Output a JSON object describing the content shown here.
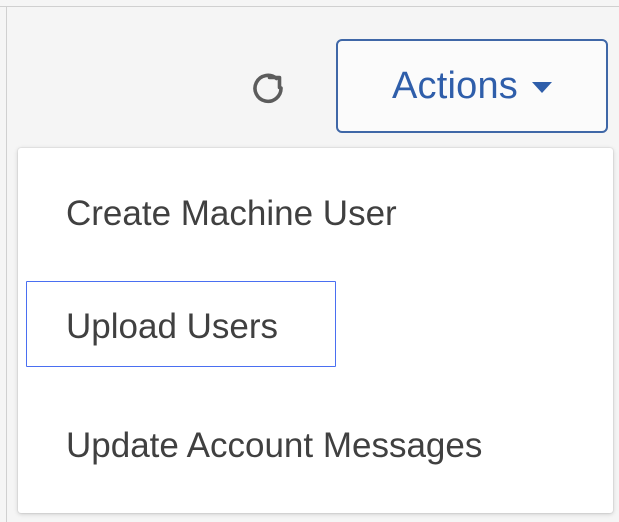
{
  "toolbar": {
    "refresh_icon": "refresh-icon",
    "actions_label": "Actions",
    "actions_caret": "caret-down-icon"
  },
  "dropdown": {
    "items": [
      {
        "label": "Create Machine User"
      },
      {
        "label": "Upload Users",
        "focused": true
      },
      {
        "label": "Update Account Messages"
      }
    ]
  },
  "colors": {
    "accent": "#2f5eaa",
    "focus": "#4a6ff1",
    "text": "#404040",
    "menu_bg": "#ffffff",
    "page_bg": "#f5f5f5"
  }
}
